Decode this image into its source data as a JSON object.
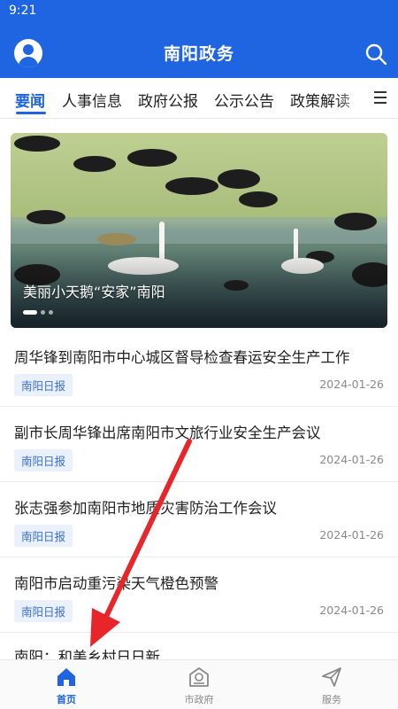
{
  "status_bar": {
    "time": "9:21"
  },
  "app_bar": {
    "title": "南阳政务",
    "avatar_icon": "user-avatar-icon",
    "search_icon": "search-icon"
  },
  "tabs": [
    {
      "label": "要闻",
      "active": true
    },
    {
      "label": "人事信息",
      "active": false
    },
    {
      "label": "政府公报",
      "active": false
    },
    {
      "label": "公示公告",
      "active": false
    },
    {
      "label": "政策解读",
      "active": false
    }
  ],
  "tabs_menu_icon": "menu-icon",
  "banner": {
    "caption": "美丽小天鹅“安家”南阳",
    "slide_count": 3,
    "active_slide": 1
  },
  "news": [
    {
      "title": "周华锋到南阳市中心城区督导检查春运安全生产工作",
      "source": "南阳日报",
      "date": "2024-01-26"
    },
    {
      "title": "副市长周华锋出席南阳市文旅行业安全生产会议",
      "source": "南阳日报",
      "date": "2024-01-26"
    },
    {
      "title": "张志强参加南阳市地质灾害防治工作会议",
      "source": "南阳日报",
      "date": "2024-01-26"
    },
    {
      "title": "南阳市启动重污染天气橙色预警",
      "source": "南阳日报",
      "date": "2024-01-26"
    },
    {
      "title": "南阳：和美乡村日日新",
      "source": "",
      "date": ""
    }
  ],
  "bottom_nav": [
    {
      "label": "首页",
      "icon": "home-icon",
      "active": true
    },
    {
      "label": "市政府",
      "icon": "government-building-icon",
      "active": false
    },
    {
      "label": "服务",
      "icon": "paper-plane-icon",
      "active": false
    }
  ],
  "colors": {
    "primary": "#1f64e0",
    "source_tag_bg": "#eaf1fd",
    "annotation_arrow": "#e8262a"
  }
}
